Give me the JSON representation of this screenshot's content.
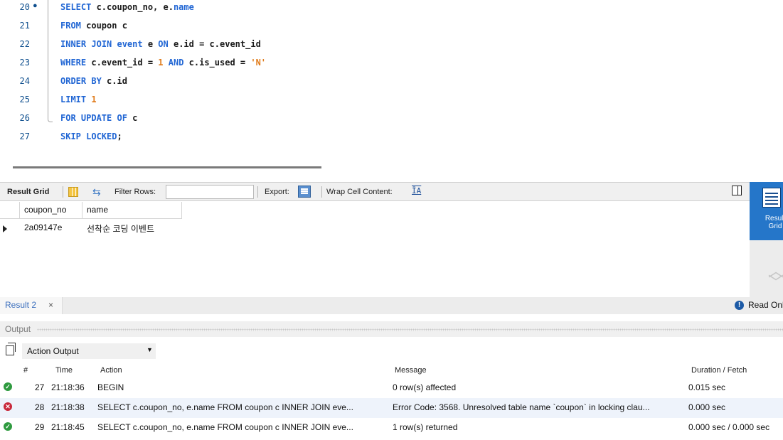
{
  "editor": {
    "lines": [
      {
        "no": "20",
        "marker": "●"
      },
      {
        "no": "21"
      },
      {
        "no": "22"
      },
      {
        "no": "23"
      },
      {
        "no": "24"
      },
      {
        "no": "25"
      },
      {
        "no": "26"
      },
      {
        "no": "27"
      }
    ],
    "code": {
      "l20": {
        "kw1": "SELECT",
        "t1": " c.coupon_no, e.",
        "kw2": "name"
      },
      "l21": {
        "kw1": "FROM",
        "t1": " coupon c"
      },
      "l22": {
        "kw1": "INNER JOIN",
        "t1": " ",
        "kw2": "event",
        "t2": " e ",
        "kw3": "ON",
        "t3": " e.id = c.event_id"
      },
      "l23": {
        "kw1": "WHERE",
        "t1": " c.event_id = ",
        "n1": "1",
        "t2": " ",
        "kw2": "AND",
        "t3": " c.is_used = ",
        "s1": "'N'"
      },
      "l24": {
        "kw1": "ORDER BY",
        "t1": " c.id"
      },
      "l25": {
        "kw1": "LIMIT",
        "t1": " ",
        "n1": "1"
      },
      "l26": {
        "kw1": "FOR UPDATE OF",
        "t1": " c"
      },
      "l27": {
        "kw1": "SKIP LOCKED",
        "t1": ";"
      }
    }
  },
  "toolbar": {
    "result_grid_label": "Result Grid",
    "filter_rows_label": "Filter Rows:",
    "filter_value": "",
    "export_label": "Export:",
    "wrap_label": "Wrap Cell Content:",
    "wrap_icon_glyph": "ĪA"
  },
  "side_panel": {
    "label_line1": "Result",
    "label_line2": "Grid"
  },
  "result_grid": {
    "columns": [
      "coupon_no",
      "name"
    ],
    "rows": [
      [
        "2a09147e",
        "선착순 코딩 이벤트"
      ]
    ]
  },
  "tabs": {
    "result_tab": "Result 2",
    "close_glyph": "×",
    "read_only": "Read Only"
  },
  "output": {
    "title": "Output",
    "selector_value": "Action Output",
    "columns": [
      "#",
      "Time",
      "Action",
      "Message",
      "Duration / Fetch"
    ],
    "rows": [
      {
        "status": "ok",
        "num": "27",
        "time": "21:18:36",
        "action": "BEGIN",
        "message": "0 row(s) affected",
        "duration": "0.015 sec"
      },
      {
        "status": "error",
        "num": "28",
        "time": "21:18:38",
        "action": "SELECT c.coupon_no, e.name FROM coupon c INNER JOIN eve...",
        "message": "Error Code: 3568. Unresolved table name `coupon` in locking clau...",
        "duration": "0.000 sec"
      },
      {
        "status": "ok",
        "num": "29",
        "time": "21:18:45",
        "action": "SELECT c.coupon_no, e.name FROM coupon c INNER JOIN eve...",
        "message": "1 row(s) returned",
        "duration": "0.000 sec / 0.000 sec"
      }
    ]
  },
  "colors": {
    "keyword": "#2166d4",
    "number": "#e07b1a",
    "line_number": "#0f4f8e",
    "accent": "#2576c9",
    "ok": "#2e9a3f",
    "error": "#c8283a"
  }
}
